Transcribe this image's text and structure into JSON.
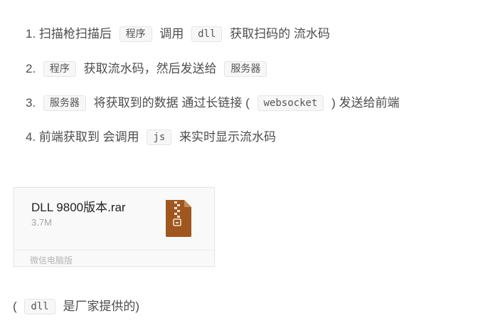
{
  "steps": [
    {
      "num": "1.",
      "text_a": "扫描枪扫描后",
      "code_a": "程序",
      "text_b": "调用",
      "code_b": "dll",
      "text_c": "获取扫码的 流水码"
    },
    {
      "num": "2.",
      "code_a": "程序",
      "text_a": "获取流水码，然后发送给",
      "code_b": "服务器"
    },
    {
      "num": "3.",
      "code_a": "服务器",
      "text_a": "将获取到的数据 通过长链接 (",
      "code_b": "websocket",
      "text_b": ") 发送给前端"
    },
    {
      "num": "4.",
      "text_a": "前端获取到 会调用",
      "code_a": "js",
      "text_b": "来实时显示流水码"
    }
  ],
  "attachment": {
    "file_name": "DLL 9800版本.rar",
    "file_size": "3.7M",
    "source": "微信电脑版",
    "icon": "zip-archive-icon",
    "icon_color": "#a0561f"
  },
  "note": {
    "open": "(",
    "code": "dll",
    "text": "是厂家提供的)"
  }
}
